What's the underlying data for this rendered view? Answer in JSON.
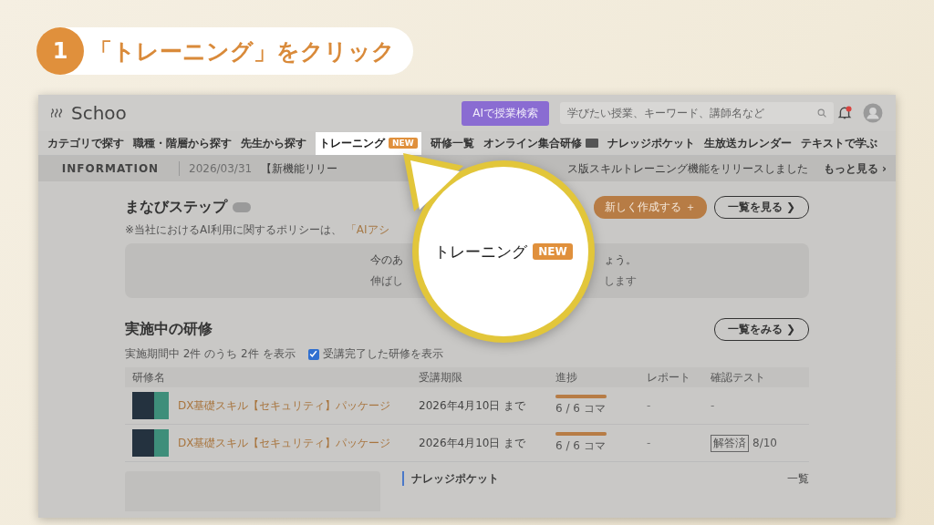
{
  "step": {
    "number": "1",
    "title": "「トレーニング」をクリック"
  },
  "app": {
    "logo": "Schoo",
    "ai_button": "AIで授業検索",
    "search": {
      "placeholder": "学びたい授業、キーワード、講師名など"
    },
    "notifications": {
      "unread": true
    }
  },
  "nav": [
    {
      "label": "カテゴリで探す",
      "selected": false
    },
    {
      "label": "職種・階層から探す",
      "selected": false
    },
    {
      "label": "先生から探す",
      "selected": false
    },
    {
      "label": "トレーニング",
      "badge": "NEW",
      "selected": true
    },
    {
      "label": "研修一覧",
      "selected": false
    },
    {
      "label": "オンライン集合研修",
      "flag": true,
      "selected": false
    },
    {
      "label": "ナレッジポケット",
      "selected": false
    },
    {
      "label": "生放送カレンダー",
      "selected": false
    },
    {
      "label": "テキストで学ぶ",
      "selected": false
    }
  ],
  "information": {
    "heading": "INFORMATION",
    "date": "2026/03/31",
    "text_before": "【新機能リリー",
    "text_after": "ス版スキルトレーニング機能をリリースしました",
    "more": "もっと見る ›"
  },
  "manabi_step": {
    "title": "まなびステップ",
    "tag": true,
    "policy": "※当社におけるAI利用に関するポリシーは、",
    "policy_link": "「AIアシ",
    "create_button": "新しく作成する ＋",
    "list_button": "一覧を見る ❯",
    "empty_lines": [
      {
        "left": "今のあ",
        "right": "ょう。"
      },
      {
        "left": "伸ばし",
        "right": "します"
      }
    ]
  },
  "training": {
    "title": "実施中の研修",
    "list_button": "一覧をみる ❯",
    "summary": "実施期間中 2件 のうち 2件 を表示",
    "show_completed": {
      "label": "受講完了した研修を表示",
      "checked": true
    },
    "columns": [
      "研修名",
      "受講期限",
      "進捗",
      "レポート",
      "確認テスト"
    ],
    "rows": [
      {
        "name": "DX基礎スキル【セキュリティ】パッケージ",
        "deadline": "2026年4月10日 まで",
        "level": 1,
        "progress": "6 / 6 コマ",
        "report": "-",
        "test": "-"
      },
      {
        "name": "DX基礎スキル【セキュリティ】パッケージ",
        "deadline": "2026年4月10日 まで",
        "level": 1,
        "progress": "6 / 6 コマ",
        "report": "-",
        "test_badge": "解答済",
        "test": "8/10"
      }
    ]
  },
  "knowledge": {
    "title": "ナレッジポケット",
    "more": "一覧"
  },
  "callout": {
    "label": "トレーニング",
    "badge": "NEW"
  }
}
